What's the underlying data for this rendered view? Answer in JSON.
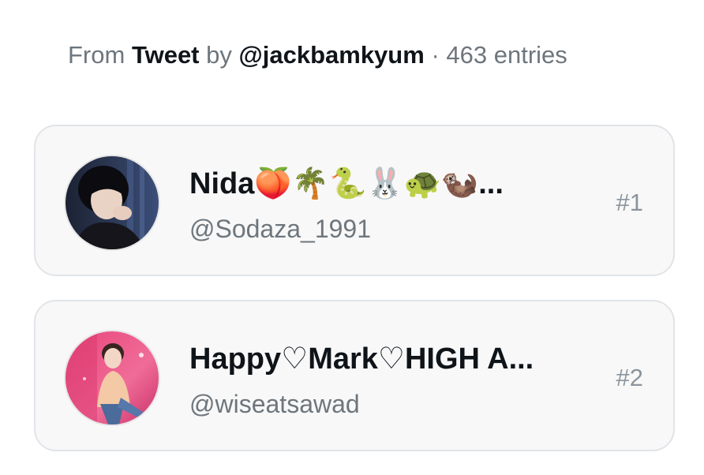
{
  "header": {
    "prefix": "From",
    "source": "Tweet",
    "by": "by",
    "author": "@jackbamkyum",
    "separator": "·",
    "count": "463 entries"
  },
  "entries": [
    {
      "name": "Nida🍑🌴🐍🐰🐢🦦...",
      "handle": "@Sodaza_1991",
      "rank": "#1",
      "avatar_icon": "person-photo-icon"
    },
    {
      "name": "Happy♡Mark♡HIGH A...",
      "handle": "@wiseatsawad",
      "rank": "#2",
      "avatar_icon": "person-photo-icon"
    }
  ]
}
